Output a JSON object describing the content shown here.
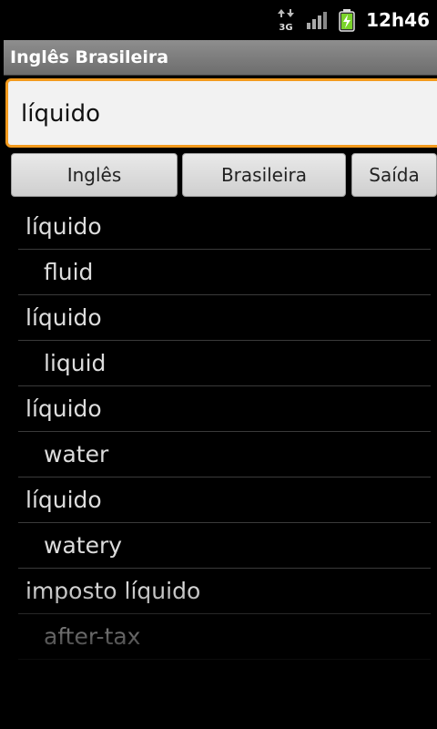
{
  "status_bar": {
    "network_label": "3G",
    "time": "12h46"
  },
  "app": {
    "title": "Inglês Brasileira"
  },
  "search": {
    "value": "líquido"
  },
  "buttons": {
    "ingles": "Inglês",
    "brasileira": "Brasileira",
    "saida": "Saída"
  },
  "results": [
    {
      "kind": "term",
      "text": "líquido"
    },
    {
      "kind": "translation",
      "text": "fluid"
    },
    {
      "kind": "term",
      "text": "líquido"
    },
    {
      "kind": "translation",
      "text": "liquid"
    },
    {
      "kind": "term",
      "text": "líquido"
    },
    {
      "kind": "translation",
      "text": "water"
    },
    {
      "kind": "term",
      "text": "líquido"
    },
    {
      "kind": "translation",
      "text": "watery"
    },
    {
      "kind": "term",
      "text": "imposto líquido"
    },
    {
      "kind": "translation",
      "text": "after-tax"
    }
  ],
  "colors": {
    "accent_focus": "#f39a1d",
    "battery_charge": "#7ad32a"
  }
}
